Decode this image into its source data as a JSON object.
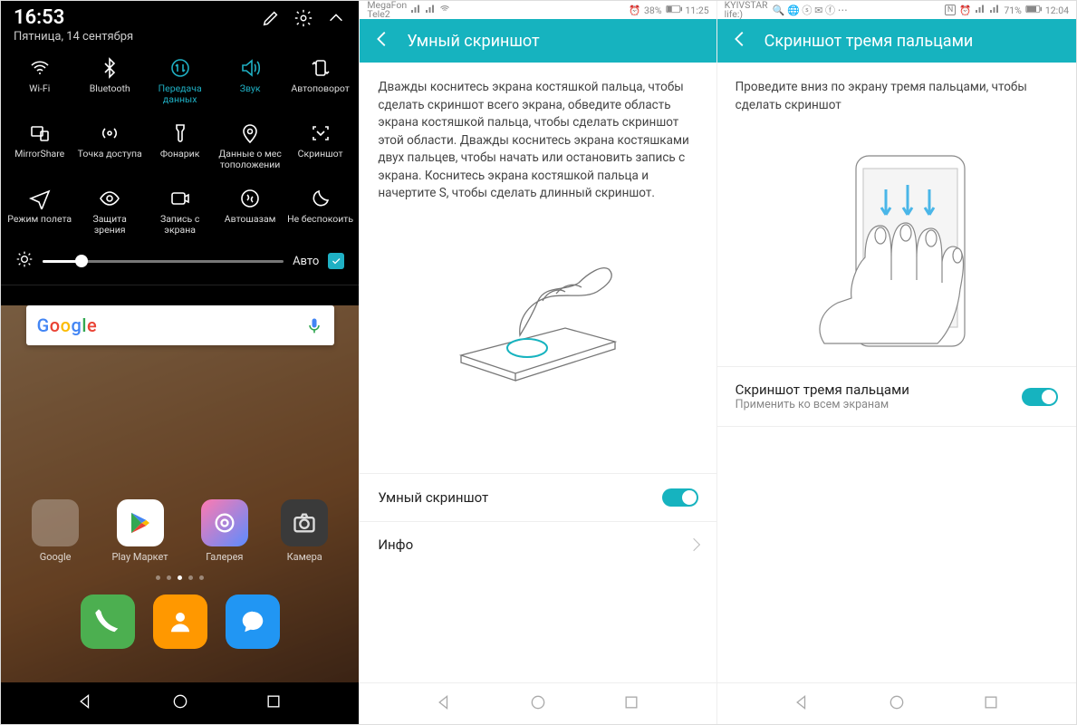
{
  "panel1": {
    "time": "16:53",
    "date": "Пятница, 14 сентября",
    "tiles": [
      {
        "label": "Wi-Fi",
        "active": false
      },
      {
        "label": "Bluetooth",
        "active": false
      },
      {
        "label": "Передача данных",
        "active": true
      },
      {
        "label": "Звук",
        "active": true
      },
      {
        "label": "Автоповорот",
        "active": false
      },
      {
        "label": "MirrorShare",
        "active": false
      },
      {
        "label": "Точка доступа",
        "active": false
      },
      {
        "label": "Фонарик",
        "active": false
      },
      {
        "label": "Данные о мес тоположении",
        "active": false
      },
      {
        "label": "Скриншот",
        "active": false
      },
      {
        "label": "Режим полета",
        "active": false
      },
      {
        "label": "Защита зрения",
        "active": false
      },
      {
        "label": "Запись с экрана",
        "active": false
      },
      {
        "label": "Автошазам",
        "active": false
      },
      {
        "label": "Не беспокоить",
        "active": false
      }
    ],
    "brightness_auto": "Авто",
    "search_brand": "Google",
    "apps": [
      "Google",
      "Play Маркет",
      "Галерея",
      "Камера"
    ]
  },
  "panel2": {
    "carrier1": "MegaFon",
    "carrier2": "Tele2",
    "battery": "38%",
    "time": "11:25",
    "title": "Умный скриншот",
    "desc": "Дважды коснитесь экрана костяшкой пальца, чтобы сделать скриншот всего экрана, обведите область экрана костяшкой пальца, чтобы сделать скриншот этой области. Дважды коснитесь экрана костяшками двух пальцев, чтобы начать или остановить запись с экрана. Коснитесь экрана костяшкой пальца и начертите S, чтобы сделать длинный скриншот.",
    "row_smart": "Умный скриншот",
    "row_info": "Инфо"
  },
  "panel3": {
    "carrier1": "KYIVSTAR",
    "carrier2": "life:)",
    "battery": "71%",
    "time": "12:04",
    "title": "Скриншот тремя пальцами",
    "desc": "Проведите вниз по экрану тремя пальцами, чтобы сделать скриншот",
    "row_title": "Скриншот тремя пальцами",
    "row_sub": "Применить ко всем экранам"
  }
}
